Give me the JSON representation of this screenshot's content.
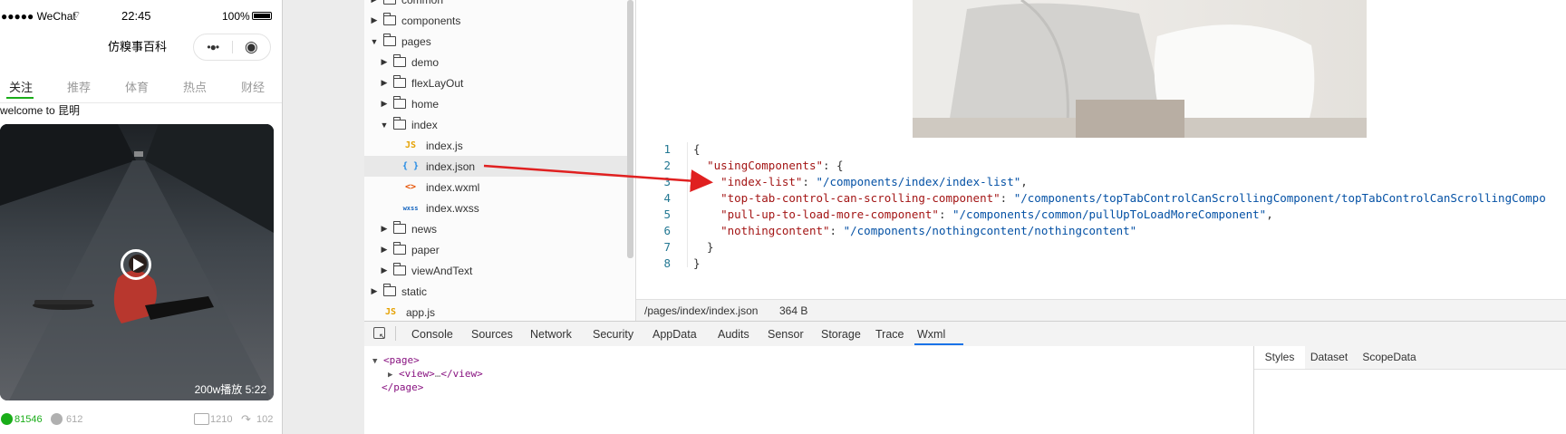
{
  "phone": {
    "status": {
      "carrier": "●●●●● WeChat",
      "time": "22:45",
      "battery": "100%"
    },
    "nav_title": "仿糗事百科",
    "capsule_more": "•●•",
    "capsule_close": "◉",
    "tabs": [
      "关注",
      "推荐",
      "体育",
      "热点",
      "财经"
    ],
    "welcome": "welcome to 昆明",
    "video_badge": "200w播放 5:22",
    "stats": {
      "likes": "81546",
      "dislikes": "612",
      "comments": "1210",
      "shares": "102"
    }
  },
  "explorer": {
    "rows": [
      {
        "label": "common",
        "type": "folder",
        "expanded": false
      },
      {
        "label": "components",
        "type": "folder",
        "expanded": false
      },
      {
        "label": "pages",
        "type": "folder",
        "expanded": true
      },
      {
        "label": "demo",
        "type": "folder",
        "expanded": false
      },
      {
        "label": "flexLayOut",
        "type": "folder",
        "expanded": false
      },
      {
        "label": "home",
        "type": "folder",
        "expanded": false
      },
      {
        "label": "index",
        "type": "folder",
        "expanded": true
      },
      {
        "label": "index.js",
        "type": "js",
        "icon": "JS"
      },
      {
        "label": "index.json",
        "type": "json",
        "icon": "{ }"
      },
      {
        "label": "index.wxml",
        "type": "wxml",
        "icon": "<>"
      },
      {
        "label": "index.wxss",
        "type": "wxss",
        "icon": "wxss"
      },
      {
        "label": "news",
        "type": "folder",
        "expanded": false
      },
      {
        "label": "paper",
        "type": "folder",
        "expanded": false
      },
      {
        "label": "viewAndText",
        "type": "folder",
        "expanded": false
      },
      {
        "label": "static",
        "type": "folder",
        "expanded": false
      },
      {
        "label": "app.js",
        "type": "js",
        "icon": "JS"
      }
    ]
  },
  "editor": {
    "line_numbers": [
      "1",
      "2",
      "3",
      "4",
      "5",
      "6",
      "7",
      "8"
    ],
    "lines": [
      {
        "parts": [
          [
            "p",
            "{"
          ]
        ]
      },
      {
        "parts": [
          [
            "p",
            "  "
          ],
          [
            "k",
            "\"usingComponents\""
          ],
          [
            "p",
            ": {"
          ]
        ]
      },
      {
        "parts": [
          [
            "p",
            "    "
          ],
          [
            "k",
            "\"index-list\""
          ],
          [
            "p",
            ": "
          ],
          [
            "s",
            "\"/components/index/index-list\""
          ],
          [
            "p",
            ","
          ]
        ]
      },
      {
        "parts": [
          [
            "p",
            "    "
          ],
          [
            "k",
            "\"top-tab-control-can-scrolling-component\""
          ],
          [
            "p",
            ": "
          ],
          [
            "s",
            "\"/components/topTabControlCanScrollingComponent/topTabControlCanScrollingCompo"
          ]
        ]
      },
      {
        "parts": [
          [
            "p",
            "    "
          ],
          [
            "k",
            "\"pull-up-to-load-more-component\""
          ],
          [
            "p",
            ": "
          ],
          [
            "s",
            "\"/components/common/pullUpToLoadMoreComponent\""
          ],
          [
            "p",
            ","
          ]
        ]
      },
      {
        "parts": [
          [
            "p",
            "    "
          ],
          [
            "k",
            "\"nothingcontent\""
          ],
          [
            "p",
            ": "
          ],
          [
            "s",
            "\"/components/nothingcontent/nothingcontent\""
          ]
        ]
      },
      {
        "parts": [
          [
            "p",
            "  }"
          ]
        ]
      },
      {
        "parts": [
          [
            "p",
            "}"
          ]
        ]
      }
    ],
    "file_path": "/pages/index/index.json",
    "file_size": "364 B"
  },
  "devtools": {
    "tabs": [
      "Console",
      "Sources",
      "Network",
      "Security",
      "AppData",
      "Audits",
      "Sensor",
      "Storage",
      "Trace",
      "Wxml"
    ],
    "active_tab": "Wxml",
    "wxml": {
      "line1": "<page>",
      "line2_open": "<view>",
      "line2_ellipsis": "…",
      "line2_close": "</view>",
      "line3": "</page>"
    },
    "side_tabs": [
      "Styles",
      "Dataset",
      "ScopeData"
    ],
    "active_side_tab": "Styles"
  },
  "colors": {
    "accent_green": "#1aad19",
    "arrow_red": "#e02020",
    "devtools_active": "#1a73e8"
  }
}
